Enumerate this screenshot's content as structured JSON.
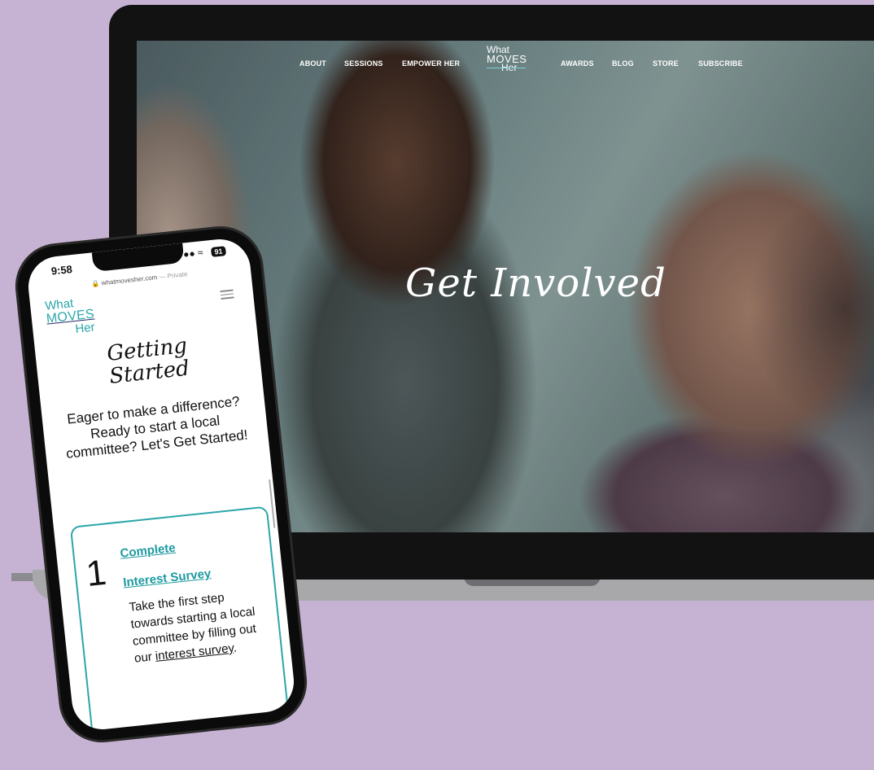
{
  "desktop": {
    "nav": {
      "about": "ABOUT",
      "sessions": "SESSIONS",
      "empower_her": "EMPOWER HER",
      "awards": "AWARDS",
      "blog": "BLOG",
      "store": "STORE",
      "subscribe": "SUBSCRIBE"
    },
    "logo": {
      "line1": "What",
      "line2": "MOVES",
      "line3": "Her"
    },
    "hero_title": "Get Involved"
  },
  "mobile": {
    "status": {
      "time": "9:58",
      "battery": "91"
    },
    "url": "whatmovesher.com",
    "url_suffix": "— Private",
    "logo": {
      "line1": "What",
      "line2": "MOVES",
      "line3": "Her"
    },
    "heading_line1": "Getting",
    "heading_line2": "Started",
    "intro": "Eager to make a difference? Ready to start a local committee? Let's Get Started!",
    "step": {
      "number": "1",
      "link_line1": "Complete",
      "link_line2": "Interest Survey",
      "desc_before": "Take the first step towards starting a local committee by filling out our ",
      "desc_link": "interest survey",
      "desc_after": "."
    }
  },
  "colors": {
    "background": "#c6b2d2",
    "accent": "#2ba6a9"
  }
}
